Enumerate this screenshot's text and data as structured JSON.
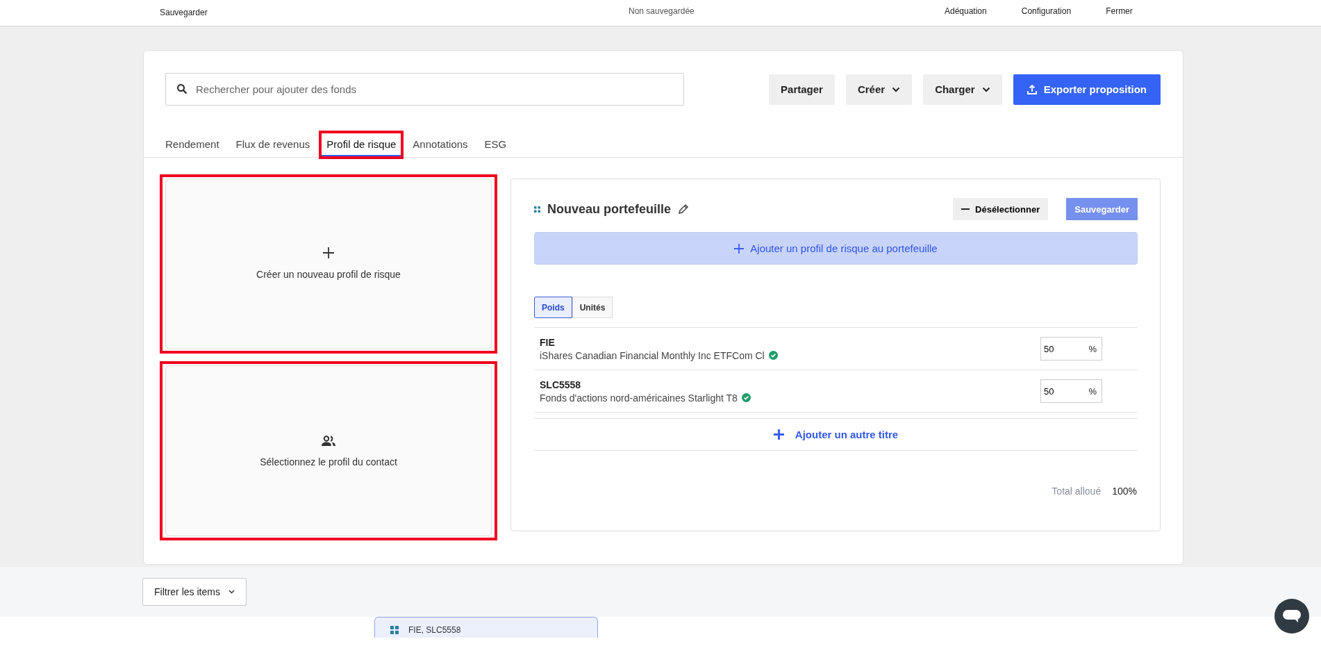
{
  "top_bar": {
    "save_label": "Sauvegarder",
    "status": "Non sauvegardée",
    "actions": [
      "Adéquation",
      "Configuration",
      "Fermer"
    ]
  },
  "toolbar": {
    "search": {
      "placeholder": "Rechercher pour ajouter des fonds"
    },
    "buttons": [
      {
        "label": "Partager",
        "kind": "plain"
      },
      {
        "label": "Créer",
        "kind": "dropdown"
      },
      {
        "label": "Charger",
        "kind": "dropdown"
      },
      {
        "label": "Exporter proposition",
        "kind": "primary"
      }
    ]
  },
  "tabs": [
    {
      "label": "Rendement",
      "selected": false,
      "highlighted": false
    },
    {
      "label": "Flux de revenus",
      "selected": false,
      "highlighted": false
    },
    {
      "label": "Profil de risque",
      "selected": true,
      "highlighted": true
    },
    {
      "label": "Annotations",
      "selected": false,
      "highlighted": false
    },
    {
      "label": "ESG",
      "selected": false,
      "highlighted": false
    }
  ],
  "option_cards": [
    {
      "label": "Créer un nouveau profil de risque",
      "kind": "create",
      "highlighted": true
    },
    {
      "label": "Sélectionnez le profil du contact",
      "kind": "contact",
      "highlighted": true
    }
  ],
  "portfolio": {
    "title": "Nouveau portefeuille",
    "deselect_label": "Désélectionner",
    "save_label": "Sauvegarder",
    "save_disabled": true,
    "add_profile_label": "Ajouter un profil de risque au portefeuille",
    "units_toggle": [
      {
        "label": "Poids",
        "selected": true
      },
      {
        "label": "Unités",
        "selected": false
      }
    ],
    "holdings": [
      {
        "code": "FIE",
        "name": "iShares Canadian Financial Monthly Inc ETFCom Cl",
        "verified": true,
        "value": "50",
        "unit": "%"
      },
      {
        "code": "SLC5558",
        "name": "Fonds d'actions nord-américaines Starlight T8",
        "verified": true,
        "value": "50",
        "unit": "%"
      }
    ],
    "add_holding_label": "Ajouter un autre titre",
    "total_label": "Total alloué",
    "total_value": "100%"
  },
  "filter": {
    "label": "Filtrer les items"
  },
  "bottom_card": {
    "title": "FIE, SLC5558"
  }
}
